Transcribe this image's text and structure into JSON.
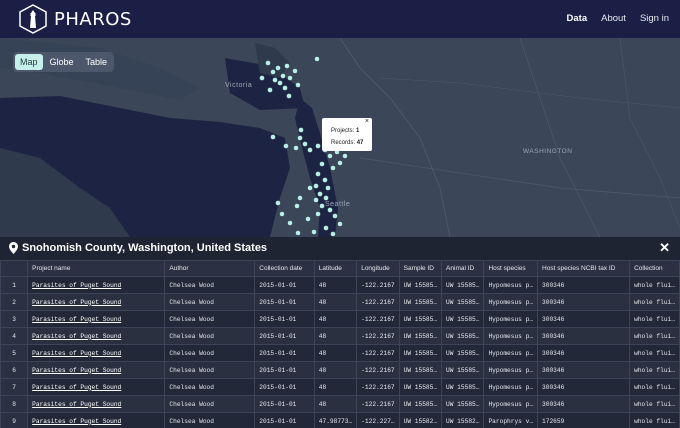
{
  "nav": {
    "brand": "PHAROS",
    "links": [
      {
        "label": "Data",
        "active": true
      },
      {
        "label": "About",
        "active": false
      },
      {
        "label": "Sign in",
        "active": false
      }
    ]
  },
  "view_toggle": {
    "options": [
      "Map",
      "Globe",
      "Table"
    ],
    "selected": "Map"
  },
  "map": {
    "labels": [
      "Victoria",
      "WASHINGTON",
      "Seattle"
    ],
    "popup": {
      "projects_label": "Projects:",
      "projects_value": "1",
      "records_label": "Records:",
      "records_value": "47",
      "close": "×"
    },
    "point_color": "#b8f0e6",
    "land_color": "#3b4658",
    "water_color": "#1d2342"
  },
  "panel": {
    "title": "Snohomish County, Washington, United States",
    "close": "✕",
    "icon": "map-pin-icon"
  },
  "table": {
    "columns": [
      "",
      "Project name",
      "Author",
      "Collection date",
      "Latitude",
      "Longitude",
      "Sample ID",
      "Animal ID",
      "Host species",
      "Host species NCBI tax ID",
      "Collection"
    ],
    "rows": [
      [
        "1",
        "Parasites of Puget Sound",
        "Chelsea Wood",
        "2015-01-01",
        "48",
        "-122.2167",
        "UW 15585…",
        "UW 15585…",
        "Hypomesus p…",
        "300346",
        "whole flui…"
      ],
      [
        "2",
        "Parasites of Puget Sound",
        "Chelsea Wood",
        "2015-01-01",
        "48",
        "-122.2167",
        "UW 15585…",
        "UW 15585…",
        "Hypomesus p…",
        "300346",
        "whole flui…"
      ],
      [
        "3",
        "Parasites of Puget Sound",
        "Chelsea Wood",
        "2015-01-01",
        "48",
        "-122.2167",
        "UW 15585…",
        "UW 15585…",
        "Hypomesus p…",
        "300346",
        "whole flui…"
      ],
      [
        "4",
        "Parasites of Puget Sound",
        "Chelsea Wood",
        "2015-01-01",
        "48",
        "-122.2167",
        "UW 15585…",
        "UW 15585…",
        "Hypomesus p…",
        "300346",
        "whole flui…"
      ],
      [
        "5",
        "Parasites of Puget Sound",
        "Chelsea Wood",
        "2015-01-01",
        "48",
        "-122.2167",
        "UW 15585…",
        "UW 15585…",
        "Hypomesus p…",
        "300346",
        "whole flui…"
      ],
      [
        "6",
        "Parasites of Puget Sound",
        "Chelsea Wood",
        "2015-01-01",
        "48",
        "-122.2167",
        "UW 15585…",
        "UW 15585…",
        "Hypomesus p…",
        "300346",
        "whole flui…"
      ],
      [
        "7",
        "Parasites of Puget Sound",
        "Chelsea Wood",
        "2015-01-01",
        "48",
        "-122.2167",
        "UW 15585…",
        "UW 15585…",
        "Hypomesus p…",
        "300346",
        "whole flui…"
      ],
      [
        "8",
        "Parasites of Puget Sound",
        "Chelsea Wood",
        "2015-01-01",
        "48",
        "-122.2167",
        "UW 15585…",
        "UW 15585…",
        "Hypomesus p…",
        "300346",
        "whole flui…"
      ],
      [
        "9",
        "Parasites of Puget Sound",
        "Chelsea Wood",
        "2015-01-01",
        "47.98773…",
        "-122.227…",
        "UW 15582…",
        "UW 15582…",
        "Parophrys v…",
        "172659",
        "whole flui…"
      ]
    ]
  }
}
